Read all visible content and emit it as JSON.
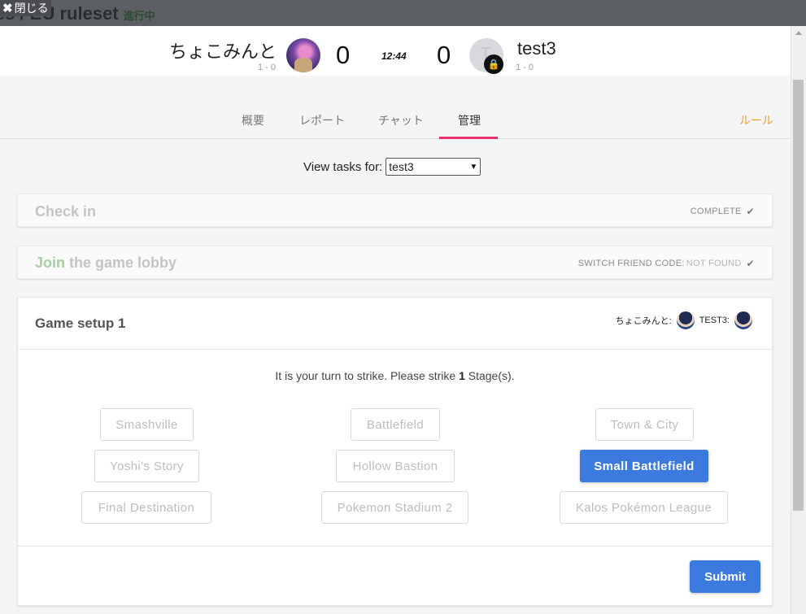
{
  "background": {
    "title": "es / EU ruleset",
    "status": "進行中"
  },
  "close": {
    "icon": "close-icon",
    "label": "閉じる"
  },
  "scoreboard": {
    "player1": {
      "name": "ちょこみんと",
      "record": "1 - 0",
      "score": "0"
    },
    "clock": "12:44",
    "player2": {
      "name": "test3",
      "avatar_letter": "T",
      "record": "1 - 0",
      "score": "0",
      "badge_icon": "lock-icon"
    }
  },
  "tabs": [
    {
      "label": "概要",
      "active": false
    },
    {
      "label": "レポート",
      "active": false
    },
    {
      "label": "チャット",
      "active": false
    },
    {
      "label": "管理",
      "active": true
    }
  ],
  "rules_link": "ルール",
  "colors": {
    "accent": "#e8326f",
    "primary": "#3d7ae0",
    "rules": "#f0a029",
    "join": "#a7cfa2"
  },
  "view_tasks": {
    "label": "View tasks for:",
    "selected": "test3"
  },
  "tasks": {
    "check_in": {
      "title": "Check in",
      "status": "COMPLETE"
    },
    "join_lobby": {
      "title_highlight": "Join",
      "title_rest": " the game lobby",
      "status_label": "SWITCH FRIEND CODE:",
      "status_value": "NOT FOUND"
    }
  },
  "game_setup": {
    "title": "Game setup 1",
    "striker1": "ちょこみんと:",
    "striker2": "test3:",
    "instruction_pre": "It is your turn to strike. Please strike ",
    "instruction_count": "1",
    "instruction_post": " Stage(s).",
    "stages": [
      [
        "Smashville",
        "Battlefield",
        "Town & City"
      ],
      [
        "Yoshi's Story",
        "Hollow Bastion",
        "Small Battlefield"
      ],
      [
        "Final Destination",
        "Pokemon Stadium 2",
        "Kalos Pokémon League"
      ]
    ],
    "selected_stage": "Small Battlefield",
    "submit": "Submit"
  }
}
